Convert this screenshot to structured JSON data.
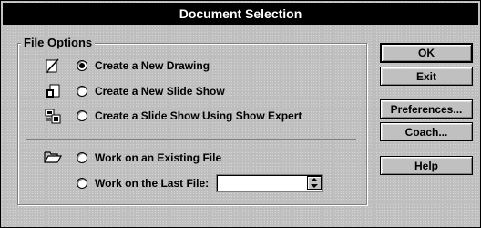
{
  "title": "Document Selection",
  "group": {
    "legend": "File Options"
  },
  "options": [
    {
      "label": "Create a New Drawing",
      "checked": true,
      "icon": "drawing-icon"
    },
    {
      "label": "Create a New Slide Show",
      "checked": false,
      "icon": "slide-show-icon"
    },
    {
      "label": "Create a Slide Show Using Show Expert",
      "checked": false,
      "icon": "show-expert-icon"
    },
    {
      "label": "Work on an Existing File",
      "checked": false,
      "icon": "open-folder-icon"
    },
    {
      "label": "Work on the Last File:",
      "checked": false,
      "icon": ""
    }
  ],
  "last_file": {
    "value": ""
  },
  "buttons": {
    "ok": "OK",
    "exit": "Exit",
    "preferences": "Preferences...",
    "coach": "Coach...",
    "help": "Help"
  }
}
